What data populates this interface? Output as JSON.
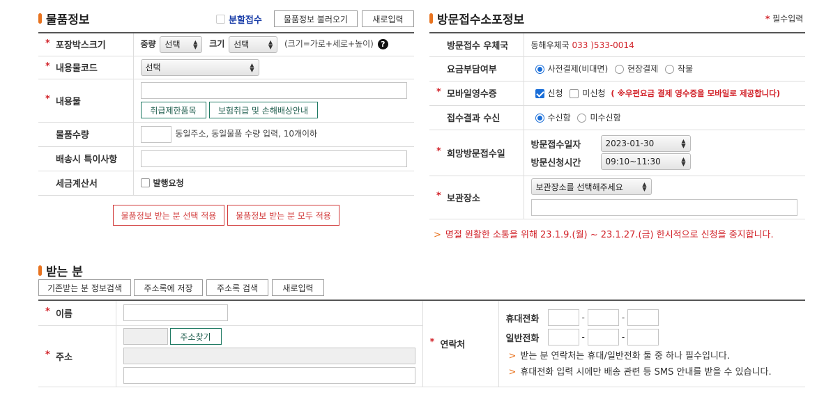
{
  "item_section": {
    "title": "물품정보",
    "split_label": "분할접수",
    "load_button": "물품정보 불러오기",
    "new_button": "새로입력",
    "rows": {
      "box_size": {
        "label": "포장박스크기",
        "weight_label": "중량",
        "weight_value": "선택",
        "size_label": "크기",
        "size_value": "선택",
        "hint": "(크기=가로+세로+높이)"
      },
      "content_code": {
        "label": "내용물코드",
        "value": "선택"
      },
      "content": {
        "label": "내용물",
        "restrict_button": "취급제한품목",
        "insurance_button": "보험취급 및 손해배상안내"
      },
      "quantity": {
        "label": "물품수량",
        "hint": "동일주소, 동일물품 수량 입력, 10개이하"
      },
      "special": {
        "label": "배송시 특이사항"
      },
      "tax": {
        "label": "세금계산서",
        "option": "발행요청"
      }
    },
    "apply_selected": "물품정보 받는 분 선택 적용",
    "apply_all": "물품정보 받는 분 모두 적용"
  },
  "visit_section": {
    "title": "방문접수소포정보",
    "required_note": "필수입력",
    "rows": {
      "post_office": {
        "label": "방문접수 우체국",
        "name": "동해우체국",
        "phone": "033 )533-0014"
      },
      "fee": {
        "label": "요금부담여부",
        "options": [
          "사전결제(비대면)",
          "현장결제",
          "착불"
        ]
      },
      "receipt": {
        "label": "모바일영수증",
        "opt_yes": "신청",
        "opt_no": "미신청",
        "note": "( ※우편요금 결제 영수증을 모바일로 제공합니다)"
      },
      "result": {
        "label": "접수결과 수신",
        "opt_yes": "수신함",
        "opt_no": "미수신함"
      },
      "wish_date": {
        "label": "희망방문접수일",
        "date_label": "방문접수일자",
        "date_value": "2023-01-30",
        "time_label": "방문신청시간",
        "time_value": "09:10~11:30"
      },
      "storage": {
        "label": "보관장소",
        "select_value": "보관장소를 선택해주세요"
      }
    },
    "notice": "명절 원활한 소통을 위해 23.1.9.(월) ~ 23.1.27.(금) 한시적으로 신청을 중지합니다."
  },
  "receiver_section": {
    "title": "받는 분",
    "buttons": [
      "기존받는 분 정보검색",
      "주소록에 저장",
      "주소록 검색",
      "새로입력"
    ],
    "rows": {
      "name": {
        "label": "이름"
      },
      "address": {
        "label": "주소",
        "find_button": "주소찾기"
      },
      "contact": {
        "label": "연락처",
        "mobile_label": "휴대전화",
        "phone_label": "일반전화",
        "dash": "-",
        "notes": [
          "받는 분 연락처는 휴대/일반전화 둘 중 하나 필수입니다.",
          "휴대전화 입력 시에만 배송 관련 등 SMS 안내를 받을 수 있습니다."
        ]
      }
    }
  },
  "glyphs": {
    "star": "*",
    "gt": ">",
    "q": "?",
    "up": "▲",
    "down": "▼"
  },
  "colors": {
    "accent": "#e8731f",
    "required": "#d2232a",
    "link_blue": "#1a3ea8",
    "green_button": "#1f7a63"
  }
}
